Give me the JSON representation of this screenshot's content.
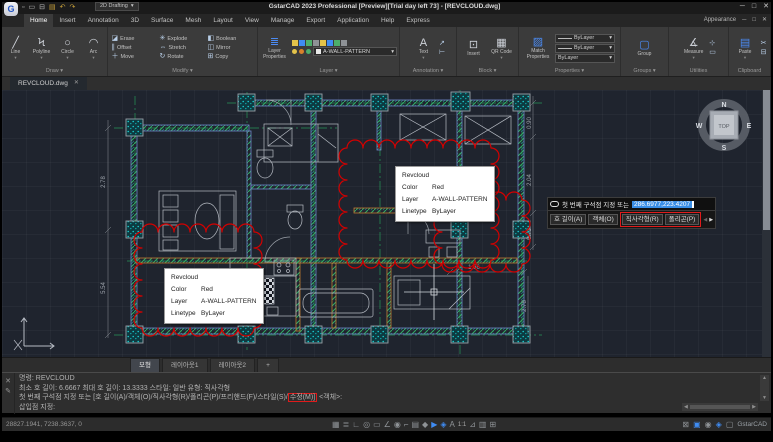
{
  "window": {
    "title": "GstarCAD 2023 Professional [Preview][Trial day left 73] - [REVCLOUD.dwg]",
    "workspace": "2D Drafting",
    "logo_letter": "G",
    "min": "─",
    "max": "□",
    "close": "✕"
  },
  "quick_access": {
    "glyphs": [
      "▫",
      "▭",
      "⊟",
      "▤",
      "↶",
      "↷"
    ],
    "dropdown": "▾"
  },
  "ribbon": {
    "tabs": [
      "Home",
      "Insert",
      "Annotation",
      "3D",
      "Surface",
      "Mesh",
      "Layout",
      "View",
      "Manage",
      "Export",
      "Application",
      "Help",
      "Express"
    ],
    "appearance": "Appearance",
    "panels": [
      {
        "label": "Draw",
        "labels": [
          "Line",
          "Polyline",
          "Circle",
          "Arc"
        ],
        "glyphs": [
          "╱",
          "Ϟ",
          "○",
          "◠"
        ]
      },
      {
        "label": "Modify",
        "labels": [
          "Erase",
          "Explode",
          "Boolean",
          "Offset",
          "Stretch",
          "Mirror",
          "Move",
          "Rotate",
          "Copy"
        ],
        "glyphs": [
          "◪",
          "✳",
          "◧",
          "∥",
          "⇔",
          "◫",
          "＋",
          "↻",
          "⊞"
        ]
      },
      {
        "label": "Layer",
        "labels": [
          "Layer",
          "Properties"
        ],
        "glyph": "≣",
        "combo": "A-WALL-PATTERN"
      },
      {
        "label": "Annotation",
        "labels": [
          "Text"
        ],
        "glyphs": [
          "A"
        ]
      },
      {
        "label": "Block",
        "labels": [
          "Insert",
          "QR Code"
        ],
        "glyphs": [
          "⊡",
          "▦"
        ]
      },
      {
        "label": "Properties",
        "labels": [
          "Match",
          "Properties"
        ],
        "glyph": "▨",
        "values": [
          "ByLayer",
          "ByLayer",
          "ByLayer"
        ]
      },
      {
        "label": "Groups",
        "labels": [
          "Group"
        ],
        "glyphs": [
          "▢"
        ]
      },
      {
        "label": "Utilities",
        "labels": [
          "Measure"
        ],
        "glyphs": [
          "∡"
        ]
      },
      {
        "label": "Clipboard",
        "labels": [
          "Paste"
        ],
        "glyphs": [
          "▤"
        ]
      }
    ]
  },
  "document_tab": {
    "name": "REVCLOUD.dwg",
    "close": "✕"
  },
  "drawing": {
    "tooltip": {
      "title": "Revcloud",
      "rows": [
        [
          "Color",
          "Red"
        ],
        [
          "Layer",
          "A-WALL-PATTERN"
        ],
        [
          "Linetype",
          "ByLayer"
        ]
      ]
    },
    "dimensions": {
      "left_upper": "2.78",
      "left_lower": "5.54",
      "right_upper": "0.90",
      "right_mid": "2.04",
      "right_lower": "0.73",
      "inner": "1.66",
      "right_bottom": "2.78"
    },
    "viewcube": {
      "n": "N",
      "e": "E",
      "s": "S",
      "w": "W",
      "top": "TOP"
    },
    "dynamic_input": {
      "prompt": "첫 번째 구석점 지정 또는",
      "value": "286.6977,223.4207",
      "options": [
        "호 길이(A)",
        "객체(O)",
        "직사각형(R)",
        "폴리곤(P)"
      ],
      "prev": "◀",
      "next": "▶"
    }
  },
  "layout_tabs": {
    "tabs": [
      "모형",
      "레이아웃1",
      "레이아웃2",
      "+"
    ]
  },
  "command": {
    "line1": "명령: REVCLOUD",
    "line2": "최소 호 길이:  6.6667  최대 호 길이:  13.3333  스타일: 일반   유형: 직사각형",
    "line3_pre": "첫 번째 구석점 지정 또는 [호 길이(A)/객체(O)/직사각형(R)/폴리곤(P)/프리핸드(F)/스타일(S)/",
    "line3_boxed": "수정(M)]",
    "line3_post": " <객체>:",
    "line4": "삽입점 지정:",
    "close": "✕",
    "edit": "✎"
  },
  "status": {
    "coords": "28827.1941, 7238.3637, 0",
    "scale": "1:1",
    "icons": [
      {
        "name": "snap",
        "glyph": "▦"
      },
      {
        "name": "grid",
        "glyph": "≣"
      },
      {
        "name": "ortho",
        "glyph": "∟"
      },
      {
        "name": "polar-tracking",
        "glyph": "◎"
      },
      {
        "name": "object-snap",
        "glyph": "▭"
      },
      {
        "name": "object-snap-tracking",
        "glyph": "∠"
      },
      {
        "name": "dynamic-ucs",
        "glyph": "◉"
      },
      {
        "name": "dynamic-input",
        "glyph": "⌐"
      },
      {
        "name": "lineweight",
        "glyph": "▤"
      },
      {
        "name": "transparency",
        "glyph": "◆"
      },
      {
        "name": "selection-cycling",
        "glyph": "▶"
      },
      {
        "name": "3d-osnap",
        "glyph": "◈"
      },
      {
        "name": "annotation-visibility",
        "glyph": "A"
      },
      {
        "name": "autoscale",
        "glyph": "⊿"
      },
      {
        "name": "annotation-monitor",
        "glyph": "▥"
      },
      {
        "name": "isolate-objects",
        "glyph": "⊞"
      }
    ],
    "right_icons": [
      {
        "name": "full-screen",
        "glyph": "⊠"
      },
      {
        "name": "performance",
        "glyph": "▣"
      },
      {
        "name": "notification",
        "glyph": "◉"
      },
      {
        "name": "cloud-sync",
        "glyph": "◈"
      },
      {
        "name": "clean-screen",
        "glyph": "▢"
      }
    ],
    "brand": "GstarCAD"
  },
  "colors": {
    "accent": "#3f8cf3",
    "revcloud_red": "#d40000",
    "centerline_green": "#27a25c",
    "column_teal": "#19cdd0",
    "wall_edge_blue": "#6f86c9",
    "wall_orange": "#c07830",
    "input_selection": "#3a8ee6"
  }
}
